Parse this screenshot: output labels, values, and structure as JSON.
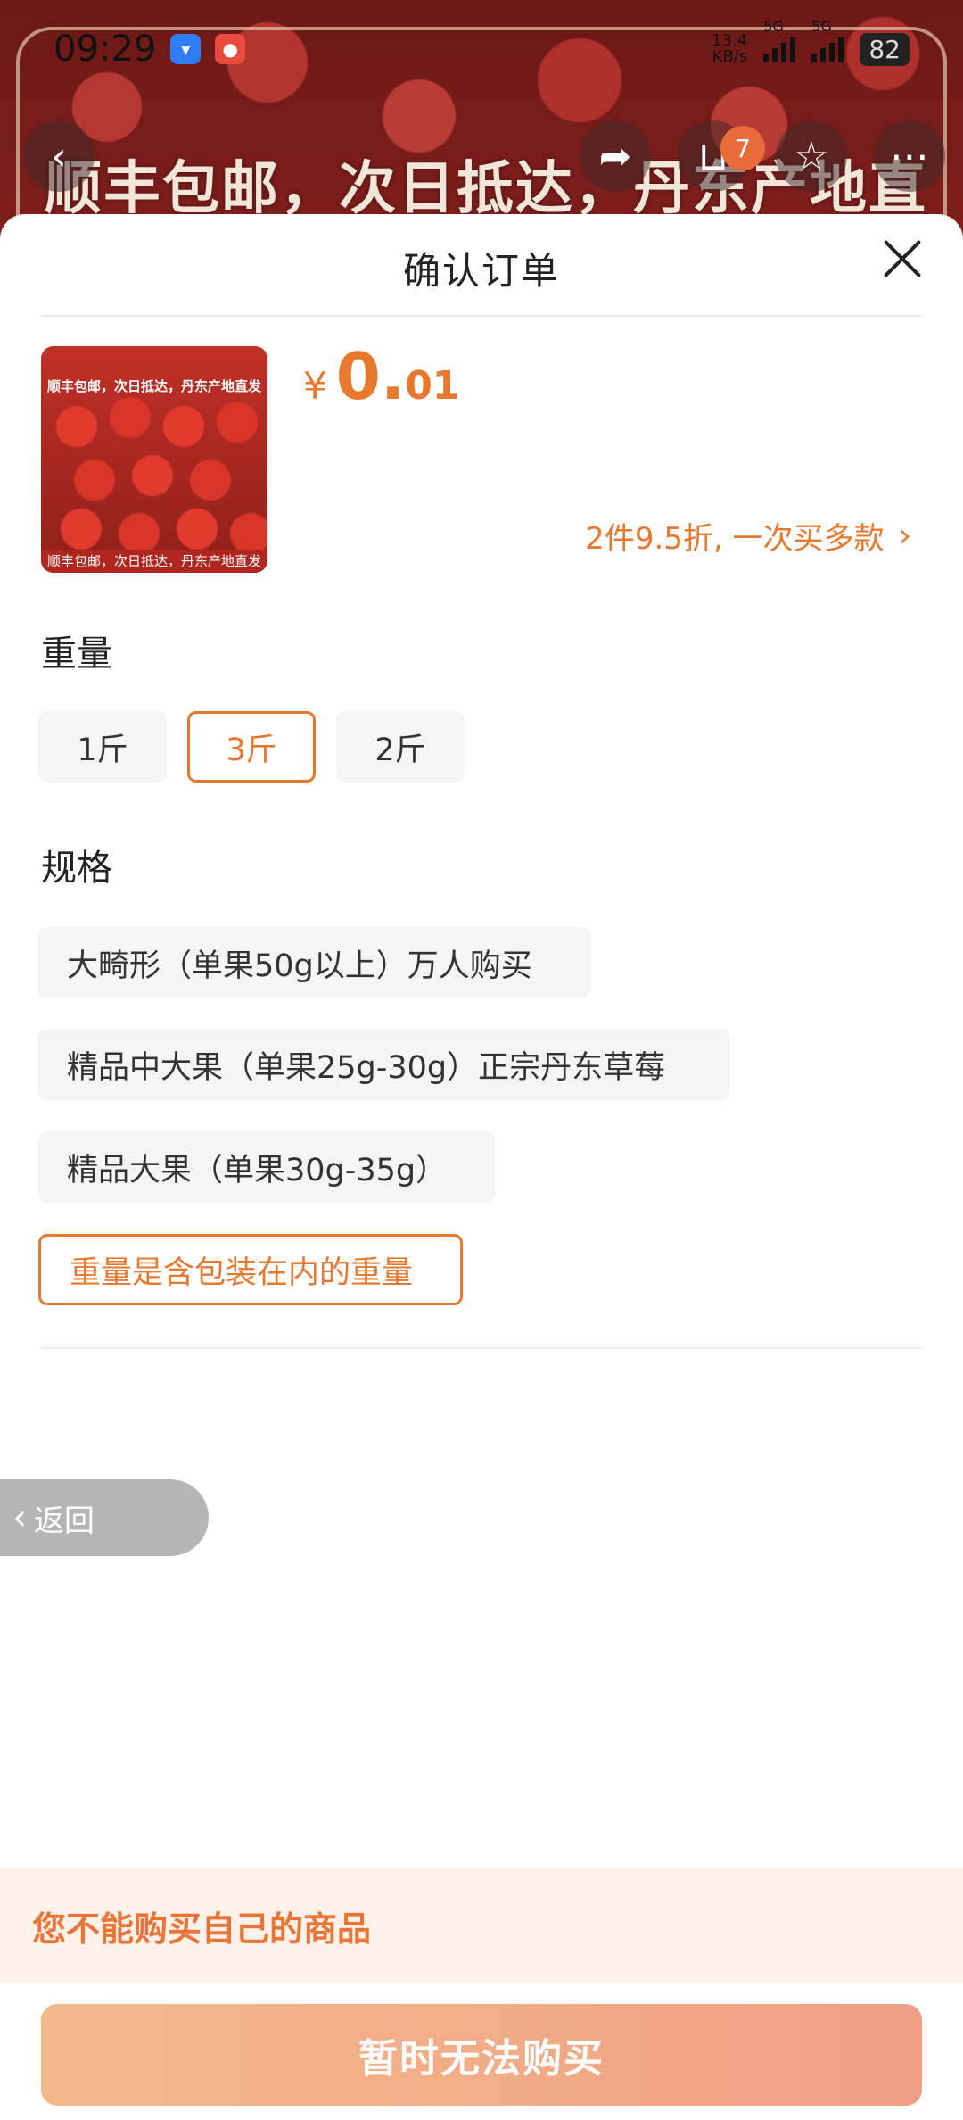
{
  "status_bar": {
    "time": "09:29",
    "net_speed_top": "13.4",
    "net_speed_unit": "KB/s",
    "signal1_label": "5G",
    "signal2_label": "5G",
    "battery": "82"
  },
  "banner": {
    "headline": "顺丰包邮，次日抵达，丹东产地直发",
    "cart_count": "7"
  },
  "sheet": {
    "title": "确认订单"
  },
  "product": {
    "thumb_top_text": "顺丰包邮，次日抵达，丹东产地直发",
    "thumb_bottom_text": "顺丰包邮，次日抵达，丹东产地直发",
    "currency": "¥",
    "price_int": "0.",
    "price_dec": "01",
    "promo": "2件9.5折, 一次买多款"
  },
  "weight": {
    "title": "重量",
    "options": [
      "1斤",
      "3斤",
      "2斤"
    ],
    "selected": "3斤"
  },
  "spec": {
    "title": "规格",
    "options": [
      "大畸形（单果50g以上）万人购买",
      "精品中大果（单果25g-30g）正宗丹东草莓",
      "精品大果（单果30g-35g）"
    ],
    "note": "重量是含包装在内的重量"
  },
  "back_label": "返回",
  "notice": "您不能购买自己的商品",
  "buy_button": "暂时无法购买",
  "colors": {
    "accent": "#e8782e",
    "notice_bg": "#fdf1ea",
    "option_bg": "#f4f5f7"
  }
}
